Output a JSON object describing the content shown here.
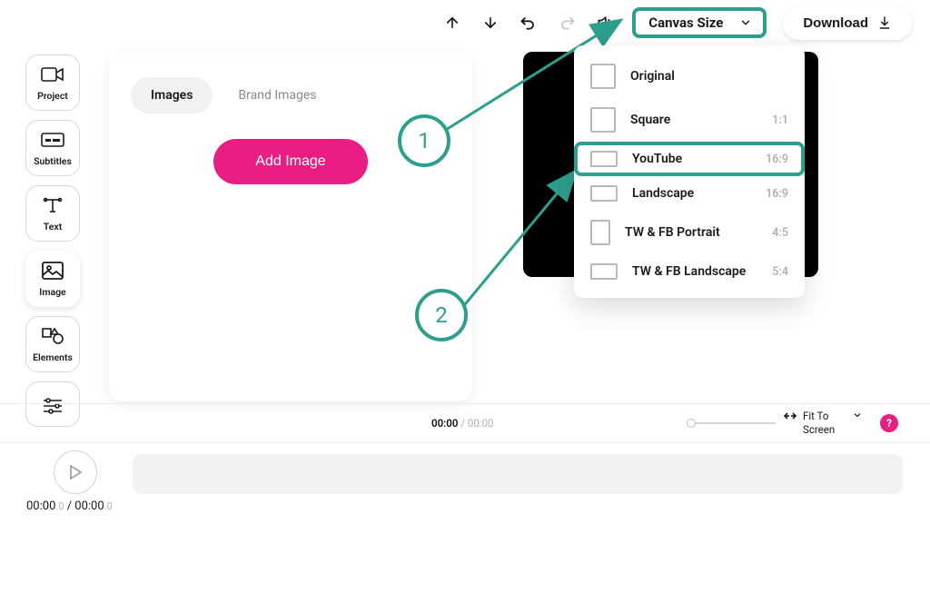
{
  "toolbar": {
    "canvas_size_label": "Canvas Size",
    "download_label": "Download"
  },
  "nav": {
    "project": "Project",
    "subtitles": "Subtitles",
    "text": "Text",
    "image": "Image",
    "elements": "Elements"
  },
  "panel": {
    "tabs": {
      "images": "Images",
      "brand_images": "Brand Images"
    },
    "add_image": "Add Image"
  },
  "dropdown": {
    "items": [
      {
        "label": "Original",
        "ratio": ""
      },
      {
        "label": "Square",
        "ratio": "1:1"
      },
      {
        "label": "YouTube",
        "ratio": "16:9"
      },
      {
        "label": "Landscape",
        "ratio": "16:9"
      },
      {
        "label": "TW & FB Portrait",
        "ratio": "4:5"
      },
      {
        "label": "TW & FB Landscape",
        "ratio": "5:4"
      }
    ]
  },
  "annotations": {
    "one": "1",
    "two": "2"
  },
  "timebar": {
    "current": "00:00",
    "sep": " / ",
    "duration": "00:00",
    "fit": "Fit To Screen",
    "help": "?"
  },
  "timeline": {
    "counter_cur": "00:00",
    "counter_cur_dec": ".0",
    "counter_sep": " / ",
    "counter_dur": "00:00",
    "counter_dur_dec": ".0"
  }
}
